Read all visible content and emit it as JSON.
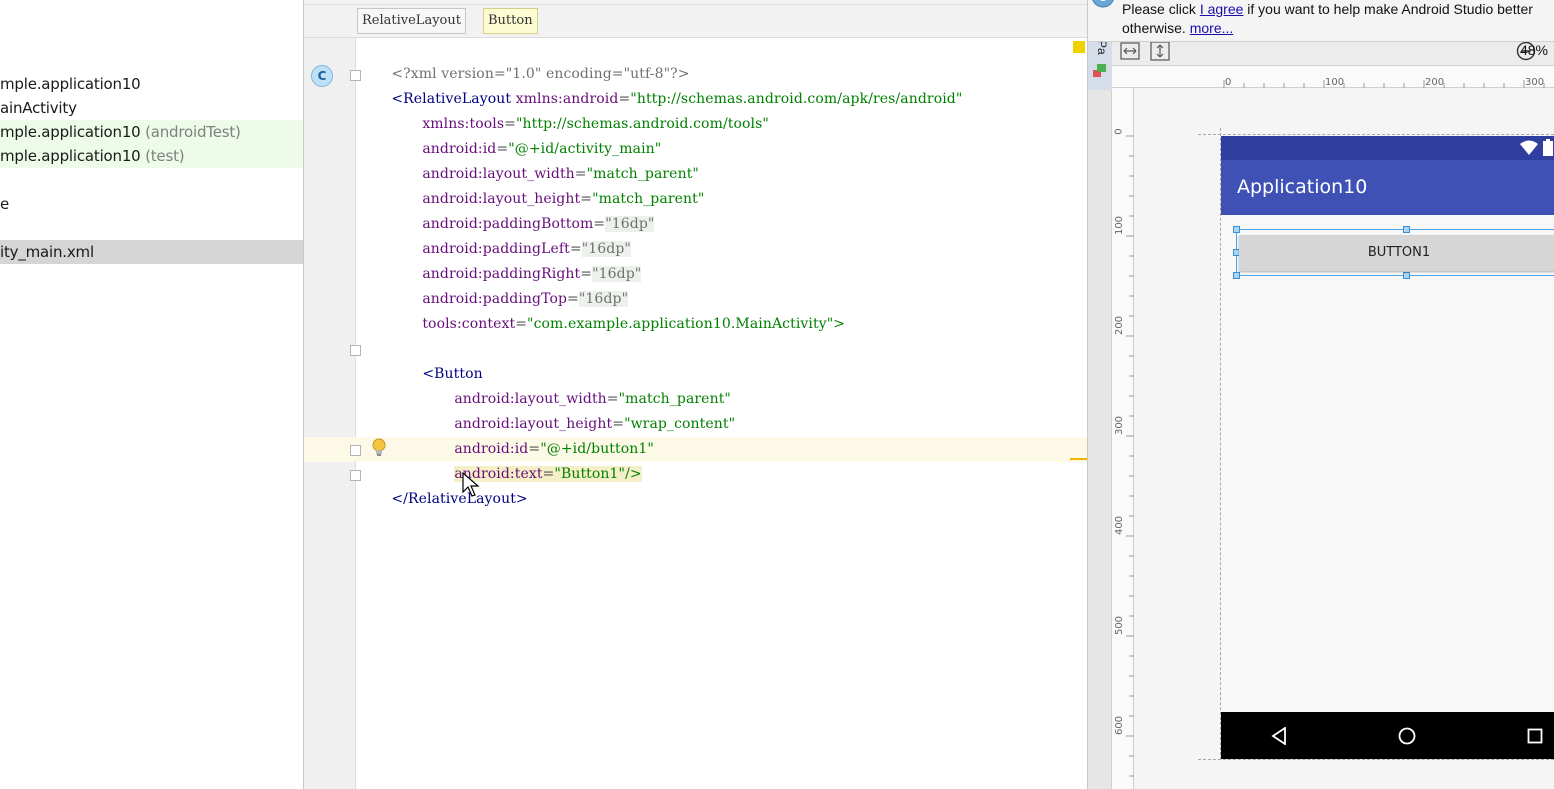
{
  "project_tree": {
    "items": [
      {
        "label": "mple.application10",
        "suffix": ""
      },
      {
        "label": "ainActivity",
        "suffix": ""
      },
      {
        "label": "mple.application10",
        "suffix": " (androidTest)"
      },
      {
        "label": "mple.application10",
        "suffix": " (test)"
      },
      {
        "label": "e",
        "suffix": ""
      },
      {
        "label": "ity_main.xml",
        "suffix": ""
      }
    ]
  },
  "breadcrumbs": [
    "RelativeLayout",
    "Button"
  ],
  "editor": {
    "xml_decl": "<?xml version=\"1.0\" encoding=\"utf-8\"?>",
    "rl_open_tag": "<RelativeLayout",
    "rl_attrs": [
      {
        "name": "xmlns:android",
        "value": "\"http://schemas.android.com/apk/res/android\""
      },
      {
        "name": "xmlns:tools",
        "value": "\"http://schemas.android.com/tools\""
      },
      {
        "name": "android:id",
        "value": "\"@+id/activity_main\""
      },
      {
        "name": "android:layout_width",
        "value": "\"match_parent\""
      },
      {
        "name": "android:layout_height",
        "value": "\"match_parent\""
      },
      {
        "name": "android:paddingBottom",
        "value": "\"16dp\""
      },
      {
        "name": "android:paddingLeft",
        "value": "\"16dp\""
      },
      {
        "name": "android:paddingRight",
        "value": "\"16dp\""
      },
      {
        "name": "android:paddingTop",
        "value": "\"16dp\""
      },
      {
        "name": "tools:context",
        "value": "\"com.example.application10.MainActivity\">"
      }
    ],
    "button_open_tag": "<Button",
    "button_attrs": [
      {
        "name": "android:layout_width",
        "value": "\"match_parent\""
      },
      {
        "name": "android:layout_height",
        "value": "\"wrap_content\""
      },
      {
        "name": "android:id",
        "value": "\"@+id/button1\""
      },
      {
        "name": "android:text",
        "value": "\"Button1\"/>"
      }
    ],
    "rl_close_tag": "</RelativeLayout>",
    "class_badge": "C"
  },
  "notification": {
    "line1_prefix": "Please click ",
    "line1_link": "I agree",
    "line1_suffix": " if you want to help make Android Studio better",
    "line2_prefix": "otherwise. ",
    "line2_link": "more..."
  },
  "preview": {
    "palette_tab": "Pa",
    "zoom": "48%",
    "ruler_h": [
      "0",
      "100",
      "200",
      "300"
    ],
    "ruler_v": [
      "0",
      "100",
      "200",
      "300",
      "400",
      "500",
      "600"
    ],
    "app_title": "Application10",
    "button_label": "BUTTON1"
  },
  "icons": {
    "class": "class-icon",
    "bulb": "lightbulb-icon",
    "zoom_out": "zoom-out-icon",
    "fit_width": "fit-width-icon",
    "fit_height": "fit-height-icon",
    "info": "info-icon",
    "wifi": "wifi-icon",
    "battery": "battery-icon",
    "back": "nav-back-icon",
    "home": "nav-home-icon",
    "recents": "nav-recents-icon"
  },
  "colors": {
    "primary": "#3f51b5",
    "primary_dark": "#303f9f",
    "xml_tag": "#000080",
    "xml_attr": "#660e7a",
    "xml_string": "#008000",
    "current_line": "#fcfae6",
    "test_source_bg": "#eefbe9",
    "selection_bg": "#d5d5d5"
  }
}
